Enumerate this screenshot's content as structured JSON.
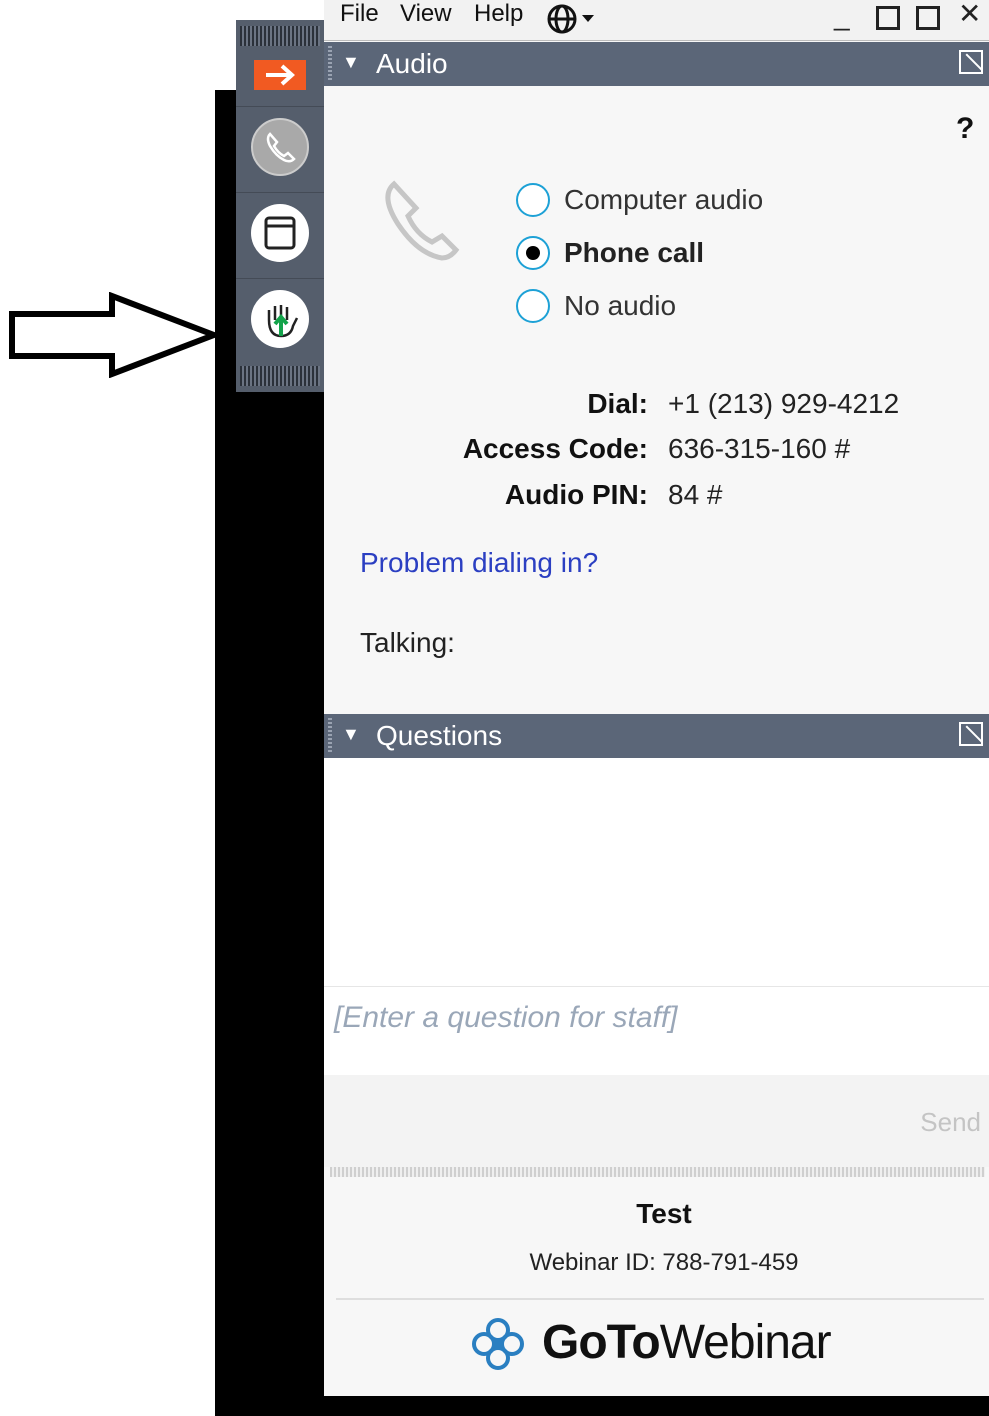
{
  "menu": {
    "file": "File",
    "view": "View",
    "help": "Help"
  },
  "audio": {
    "title": "Audio",
    "help": "?",
    "options": [
      "Computer audio",
      "Phone call",
      "No audio"
    ],
    "selected": "Phone call",
    "dial_label": "Dial:",
    "dial_value": "+1 (213) 929-4212",
    "access_label": "Access Code:",
    "access_value": "636-315-160 #",
    "pin_label": "Audio PIN:",
    "pin_value": "84 #",
    "problem_link": "Problem dialing in?",
    "talking_label": "Talking:"
  },
  "questions": {
    "title": "Questions",
    "placeholder": "[Enter a question for staff]",
    "send_label": "Send"
  },
  "footer": {
    "webinar_title": "Test",
    "webinar_id": "Webinar ID: 788-791-459",
    "brand_goto": "GoTo",
    "brand_webinar": "Webinar"
  },
  "colors": {
    "header_bg": "#5b6678",
    "toolbar_bg": "#555e6c",
    "accent_orange": "#f15a22",
    "link_blue": "#2b3fc2",
    "radio_ring": "#1da1d6"
  }
}
